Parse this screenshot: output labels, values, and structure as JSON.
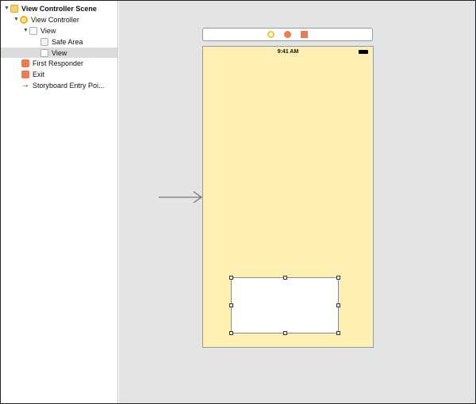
{
  "outline": {
    "items": [
      {
        "label": "View Controller Scene",
        "bold": true
      },
      {
        "label": "View Controller"
      },
      {
        "label": "View"
      },
      {
        "label": "Safe Area"
      },
      {
        "label": "View",
        "selected": true
      },
      {
        "label": "First Responder"
      },
      {
        "label": "Exit"
      },
      {
        "label": "Storyboard Entry Poi..."
      }
    ]
  },
  "phone": {
    "time": "9:41 AM",
    "background": "#feefb3"
  },
  "colors": {
    "vc": "#f0c93a",
    "responder": "#ec7b50",
    "exit": "#ec7b50",
    "canvas": "#e3e4e6"
  }
}
